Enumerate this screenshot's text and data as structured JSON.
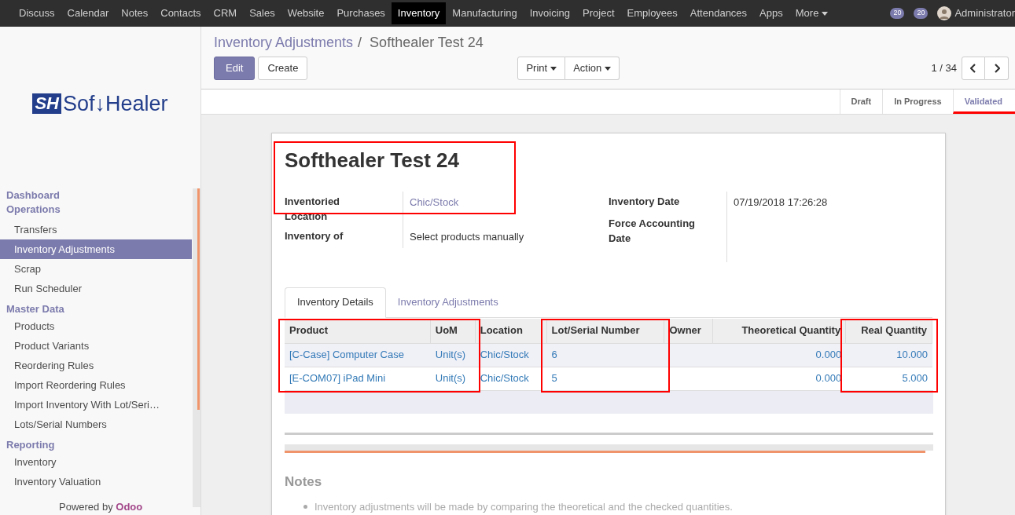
{
  "top_menu": [
    {
      "label": "Discuss",
      "selected": false
    },
    {
      "label": "Calendar",
      "selected": false
    },
    {
      "label": "Notes",
      "selected": false
    },
    {
      "label": "Contacts",
      "selected": false
    },
    {
      "label": "CRM",
      "selected": false
    },
    {
      "label": "Sales",
      "selected": false
    },
    {
      "label": "Website",
      "selected": false
    },
    {
      "label": "Purchases",
      "selected": false
    },
    {
      "label": "Inventory",
      "selected": true
    },
    {
      "label": "Manufacturing",
      "selected": false
    },
    {
      "label": "Invoicing",
      "selected": false
    },
    {
      "label": "Project",
      "selected": false
    },
    {
      "label": "Employees",
      "selected": false
    },
    {
      "label": "Attendances",
      "selected": false
    },
    {
      "label": "Apps",
      "selected": false
    },
    {
      "label": "More",
      "selected": false
    }
  ],
  "systray": {
    "activity_count": "20",
    "message_count": "20",
    "user": "Administrator"
  },
  "sidebar": {
    "logo": {
      "mark": "SH",
      "text": "Sof↓Healer"
    },
    "sections": [
      {
        "title": "Dashboard"
      },
      {
        "title": "Operations",
        "items": [
          {
            "label": "Transfers",
            "selected": false
          },
          {
            "label": "Inventory Adjustments",
            "selected": true
          },
          {
            "label": "Scrap",
            "selected": false
          },
          {
            "label": "Run Scheduler",
            "selected": false
          }
        ]
      },
      {
        "title": "Master Data",
        "items": [
          {
            "label": "Products",
            "selected": false
          },
          {
            "label": "Product Variants",
            "selected": false
          },
          {
            "label": "Reordering Rules",
            "selected": false
          },
          {
            "label": "Import Reordering Rules",
            "selected": false
          },
          {
            "label": "Import Inventory With Lot/Seri…",
            "selected": false
          },
          {
            "label": "Lots/Serial Numbers",
            "selected": false
          }
        ]
      },
      {
        "title": "Reporting",
        "items": [
          {
            "label": "Inventory",
            "selected": false
          },
          {
            "label": "Inventory Valuation",
            "selected": false
          }
        ]
      }
    ],
    "footer": {
      "prefix": "Powered by",
      "brand": "Odoo"
    }
  },
  "breadcrumb": {
    "parent": "Inventory Adjustments",
    "separator": "/",
    "current": "Softhealer Test 24"
  },
  "buttons": {
    "edit": "Edit",
    "create": "Create",
    "print": "Print",
    "action": "Action"
  },
  "pager": "1 / 34",
  "status_steps": [
    {
      "label": "Draft",
      "selected": false,
      "highlighted": false
    },
    {
      "label": "In Progress",
      "selected": false,
      "highlighted": false
    },
    {
      "label": "Validated",
      "selected": true,
      "highlighted": true
    }
  ],
  "form": {
    "title": "Softhealer Test 24",
    "title_highlighted": true,
    "left_fields": [
      {
        "label": "Inventoried Location",
        "value": "Chic/Stock",
        "kind": "link"
      },
      {
        "label": "Inventory of",
        "value": "Select products manually",
        "kind": "text"
      }
    ],
    "right_fields": [
      {
        "label": "Inventory Date",
        "value": "07/19/2018 17:26:28",
        "kind": "text"
      },
      {
        "label": "Force Accounting Date",
        "kind": "empty"
      }
    ],
    "tabs": [
      {
        "label": "Inventory Details",
        "selected": true
      },
      {
        "label": "Inventory Adjustments",
        "selected": false
      }
    ],
    "table": {
      "columns": [
        {
          "label": "Product",
          "kind": "text",
          "highlighted": true
        },
        {
          "label": "UoM",
          "kind": "text",
          "highlighted": true
        },
        {
          "label": "Location",
          "kind": "text",
          "highlighted": false
        },
        {
          "label": "Lot/Serial Number",
          "kind": "text",
          "highlighted": true
        },
        {
          "label": "Owner",
          "kind": "text",
          "highlighted": false
        },
        {
          "label": "Theoretical Quantity",
          "kind": "number",
          "highlighted": false
        },
        {
          "label": "Real Quantity",
          "kind": "number",
          "highlighted": true
        }
      ],
      "rows": [
        [
          "[C-Case] Computer Case",
          "Unit(s)",
          "Chic/Stock",
          "6",
          "",
          "0.000",
          "10.000"
        ],
        [
          "[E-COM07] iPad Mini",
          "Unit(s)",
          "Chic/Stock",
          "5",
          "",
          "0.000",
          "5.000"
        ]
      ]
    },
    "notes": {
      "title": "Notes",
      "items": [
        "Inventory adjustments will be made by comparing the theoretical and the checked quantities."
      ]
    }
  }
}
